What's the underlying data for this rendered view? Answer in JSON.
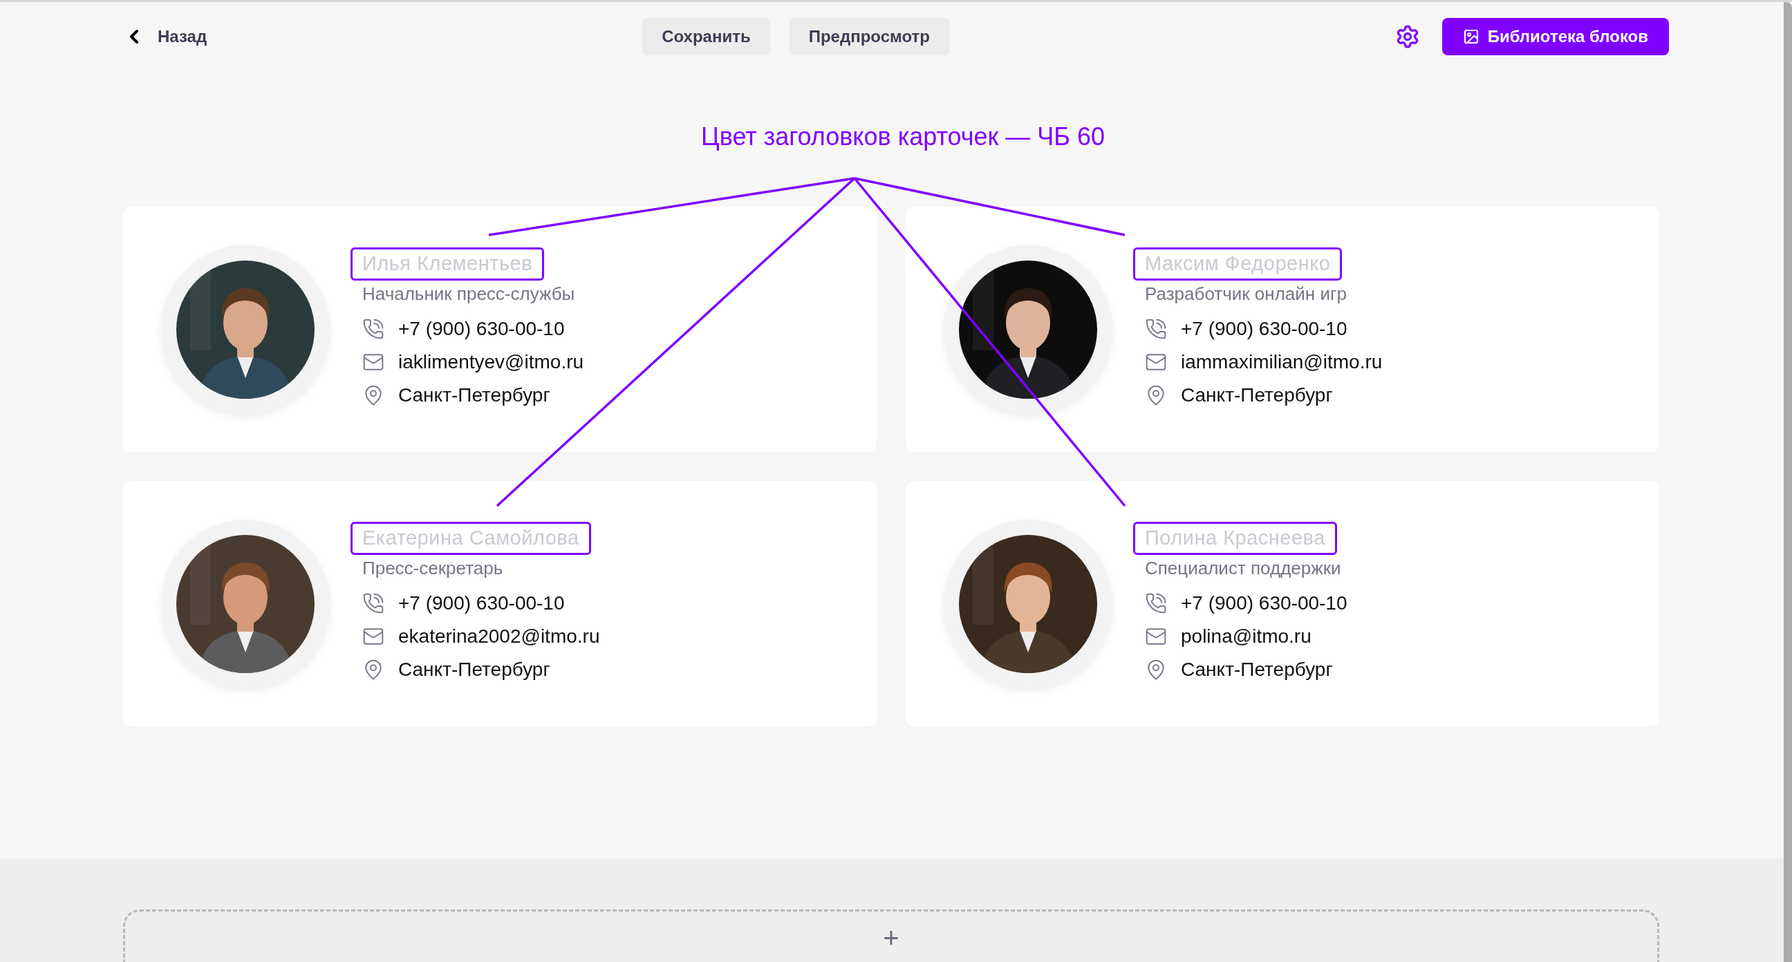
{
  "top_bar": {
    "back": {
      "label": "Назад"
    },
    "buttons": [
      {
        "label": "Сохранить"
      },
      {
        "label": "Предпросмотр"
      }
    ],
    "library_button": {
      "label": "Библиотека блоков"
    }
  },
  "annotation": {
    "text": "Цвет заголовков карточек — ЧБ 60"
  },
  "cards": [
    {
      "name": "Илья Клементьев",
      "role": "Начальник пресс-службы",
      "phone": "+7 (900) 630-00-10",
      "email": "iaklimentyev@itmo.ru",
      "city": "Санкт-Петербург"
    },
    {
      "name": "Максим Федоренко",
      "role": "Разработчик онлайн игр",
      "phone": "+7 (900) 630-00-10",
      "email": "iammaximilian@itmo.ru",
      "city": "Санкт-Петербург"
    },
    {
      "name": "Екатерина Самойлова",
      "role": "Пресс-секретарь",
      "phone": "+7 (900) 630-00-10",
      "email": "ekaterina2002@itmo.ru",
      "city": "Санкт-Петербург"
    },
    {
      "name": "Полина Краснеева",
      "role": "Специалист поддержки",
      "phone": "+7 (900) 630-00-10",
      "email": "polina@itmo.ru",
      "city": "Санкт-Петербург"
    }
  ],
  "add_block": {
    "label": "+"
  }
}
